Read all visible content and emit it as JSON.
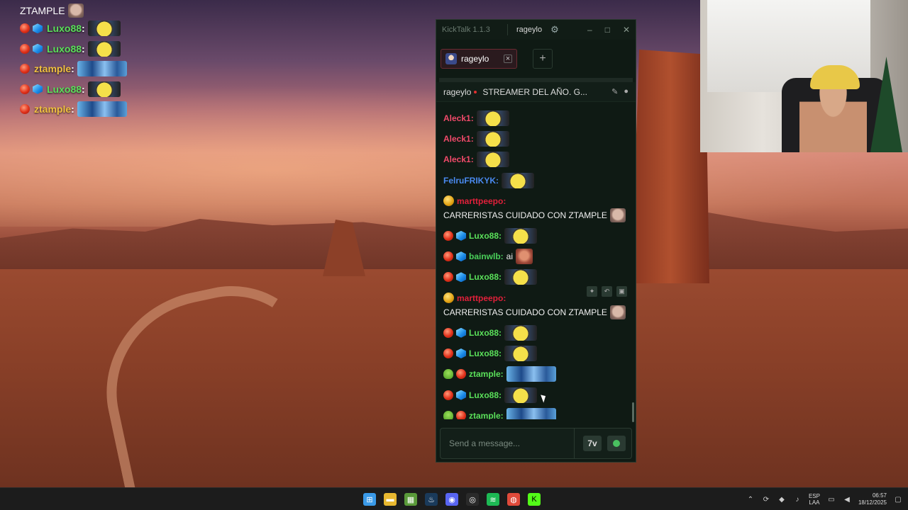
{
  "overlay": {
    "header_name": "ZTAMPLE",
    "lines": [
      {
        "badges": [
          "red",
          "cube"
        ],
        "name": "Luxo88",
        "color": "#5ae05a",
        "emote": "minion"
      },
      {
        "badges": [
          "red",
          "cube"
        ],
        "name": "Luxo88",
        "color": "#5ae05a",
        "emote": "minion"
      },
      {
        "badges": [
          "red"
        ],
        "name": "ztample",
        "color": "#f0c040",
        "emote": "duo"
      },
      {
        "badges": [
          "red",
          "cube"
        ],
        "name": "Luxo88",
        "color": "#5ae05a",
        "emote": "minion"
      },
      {
        "badges": [
          "red"
        ],
        "name": "ztample",
        "color": "#f0c040",
        "emote": "duo"
      }
    ]
  },
  "kicktalk": {
    "app_title": "KickTalk 1.1.3",
    "user": "rageylo",
    "gear_icon": "gear-icon",
    "window_buttons": [
      "–",
      "□",
      "✕"
    ],
    "tab_label": "rageylo",
    "add_tab_label": "+",
    "channel": "rageylo",
    "stream_title": "STREAMER DEL AÑO. G...",
    "input_placeholder": "Send a message...",
    "btn_7tv": "7v",
    "colors": {
      "accent": "#53fc18",
      "background": "#0f1a14"
    },
    "messages": [
      {
        "badges": [],
        "name": "Aleck1",
        "color": "#f04a6a",
        "text": "",
        "emote": "minion"
      },
      {
        "badges": [],
        "name": "Aleck1",
        "color": "#f04a6a",
        "text": "",
        "emote": "minion"
      },
      {
        "badges": [],
        "name": "Aleck1",
        "color": "#f04a6a",
        "text": "",
        "emote": "minion"
      },
      {
        "badges": [],
        "name": "FelruFRIKYK",
        "color": "#4a8af0",
        "text": "",
        "emote": "minion"
      },
      {
        "badges": [
          "coin"
        ],
        "name": "marttpeepo",
        "color": "#e0203a",
        "text": "CARRERISTAS CUIDADO CON ZTAMPLE",
        "emote": "face",
        "tall": true
      },
      {
        "badges": [
          "red",
          "cube"
        ],
        "name": "Luxo88",
        "color": "#5ae05a",
        "text": "",
        "emote": "minion"
      },
      {
        "badges": [
          "red",
          "cube"
        ],
        "name": "bainwlb",
        "color": "#4ad05a",
        "text": "ai",
        "emote": "red"
      },
      {
        "badges": [
          "red",
          "cube"
        ],
        "name": "Luxo88",
        "color": "#5ae05a",
        "text": "",
        "emote": "minion"
      },
      {
        "badges": [
          "coin"
        ],
        "name": "marttpeepo",
        "color": "#e0203a",
        "text": "CARRERISTAS CUIDADO CON ZTAMPLE",
        "emote": "face",
        "tall": true
      },
      {
        "badges": [
          "red",
          "cube"
        ],
        "name": "Luxo88",
        "color": "#5ae05a",
        "text": "",
        "emote": "minion"
      },
      {
        "badges": [
          "red",
          "cube"
        ],
        "name": "Luxo88",
        "color": "#5ae05a",
        "text": "",
        "emote": "minion"
      },
      {
        "badges": [
          "alien",
          "red"
        ],
        "name": "ztample",
        "color": "#5ae05a",
        "text": "",
        "emote": "duo"
      },
      {
        "badges": [
          "red",
          "cube"
        ],
        "name": "Luxo88",
        "color": "#5ae05a",
        "text": "",
        "emote": "minion"
      },
      {
        "badges": [
          "alien",
          "red"
        ],
        "name": "ztample",
        "color": "#5ae05a",
        "text": "",
        "emote": "duo"
      }
    ]
  },
  "taskbar": {
    "apps": [
      "windows-start",
      "file-explorer",
      "minecraft",
      "steam",
      "discord",
      "obs",
      "spotify",
      "chrome",
      "kick"
    ],
    "lang_top": "ESP",
    "lang_bottom": "LAA",
    "time": "06:57",
    "date": "18/12/2025"
  }
}
